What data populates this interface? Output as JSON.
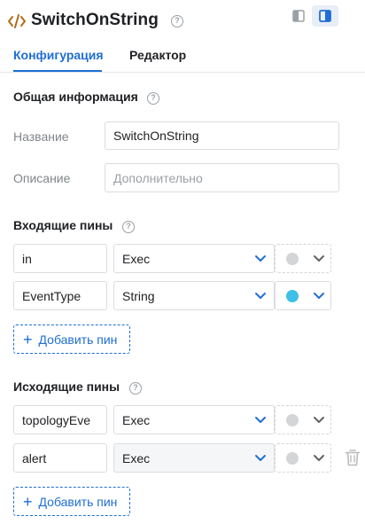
{
  "header": {
    "title": "SwitchOnString",
    "help": "?",
    "icons": [
      "code-icon",
      "help-icon",
      "panel-left-icon",
      "panel-right-icon"
    ]
  },
  "tabs": [
    {
      "label": "Конфигурация",
      "active": true
    },
    {
      "label": "Редактор",
      "active": false
    }
  ],
  "general": {
    "title": "Общая информация",
    "name_label": "Название",
    "name_value": "SwitchOnString",
    "description_label": "Описание",
    "description_placeholder": "Дополнительно"
  },
  "incoming": {
    "title": "Входящие пины",
    "pins": [
      {
        "name": "in",
        "type": "Exec",
        "color": "#d4d5d7"
      },
      {
        "name": "EventType",
        "type": "String",
        "color": "#3dbfe8"
      }
    ],
    "add_label": "Добавить пин"
  },
  "outgoing": {
    "title": "Исходящие пины",
    "pins": [
      {
        "name": "topologyEve",
        "type": "Exec",
        "color": "#d4d5d7"
      },
      {
        "name": "alert",
        "type": "Exec",
        "color": "#d4d5d7"
      }
    ],
    "add_label": "Добавить пин"
  },
  "colors": {
    "accent": "#1f6ed4",
    "text": "#202124",
    "muted": "#80868b",
    "border": "#dadce0"
  }
}
